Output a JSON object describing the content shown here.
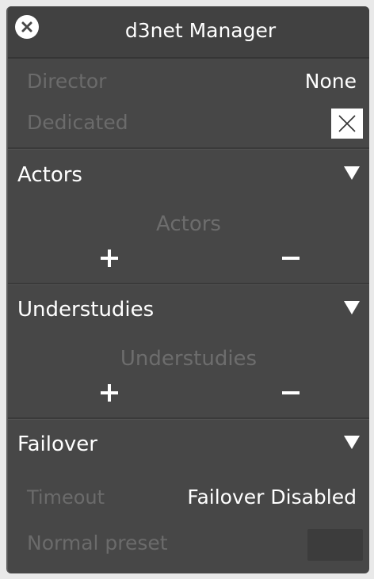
{
  "window": {
    "title": "d3net Manager"
  },
  "general": {
    "director_label": "Director",
    "director_value": "None",
    "dedicated_label": "Dedicated"
  },
  "actors": {
    "header": "Actors",
    "list_label": "Actors"
  },
  "understudies": {
    "header": "Understudies",
    "list_label": "Understudies"
  },
  "failover": {
    "header": "Failover",
    "timeout_label": "Timeout",
    "timeout_value": "Failover Disabled",
    "normal_preset_label": "Normal preset"
  },
  "icons": {
    "close": "close-icon",
    "collapse": "triangle-down-icon",
    "add": "plus-icon",
    "remove": "minus-icon",
    "checkbox": "x-mark-icon"
  }
}
